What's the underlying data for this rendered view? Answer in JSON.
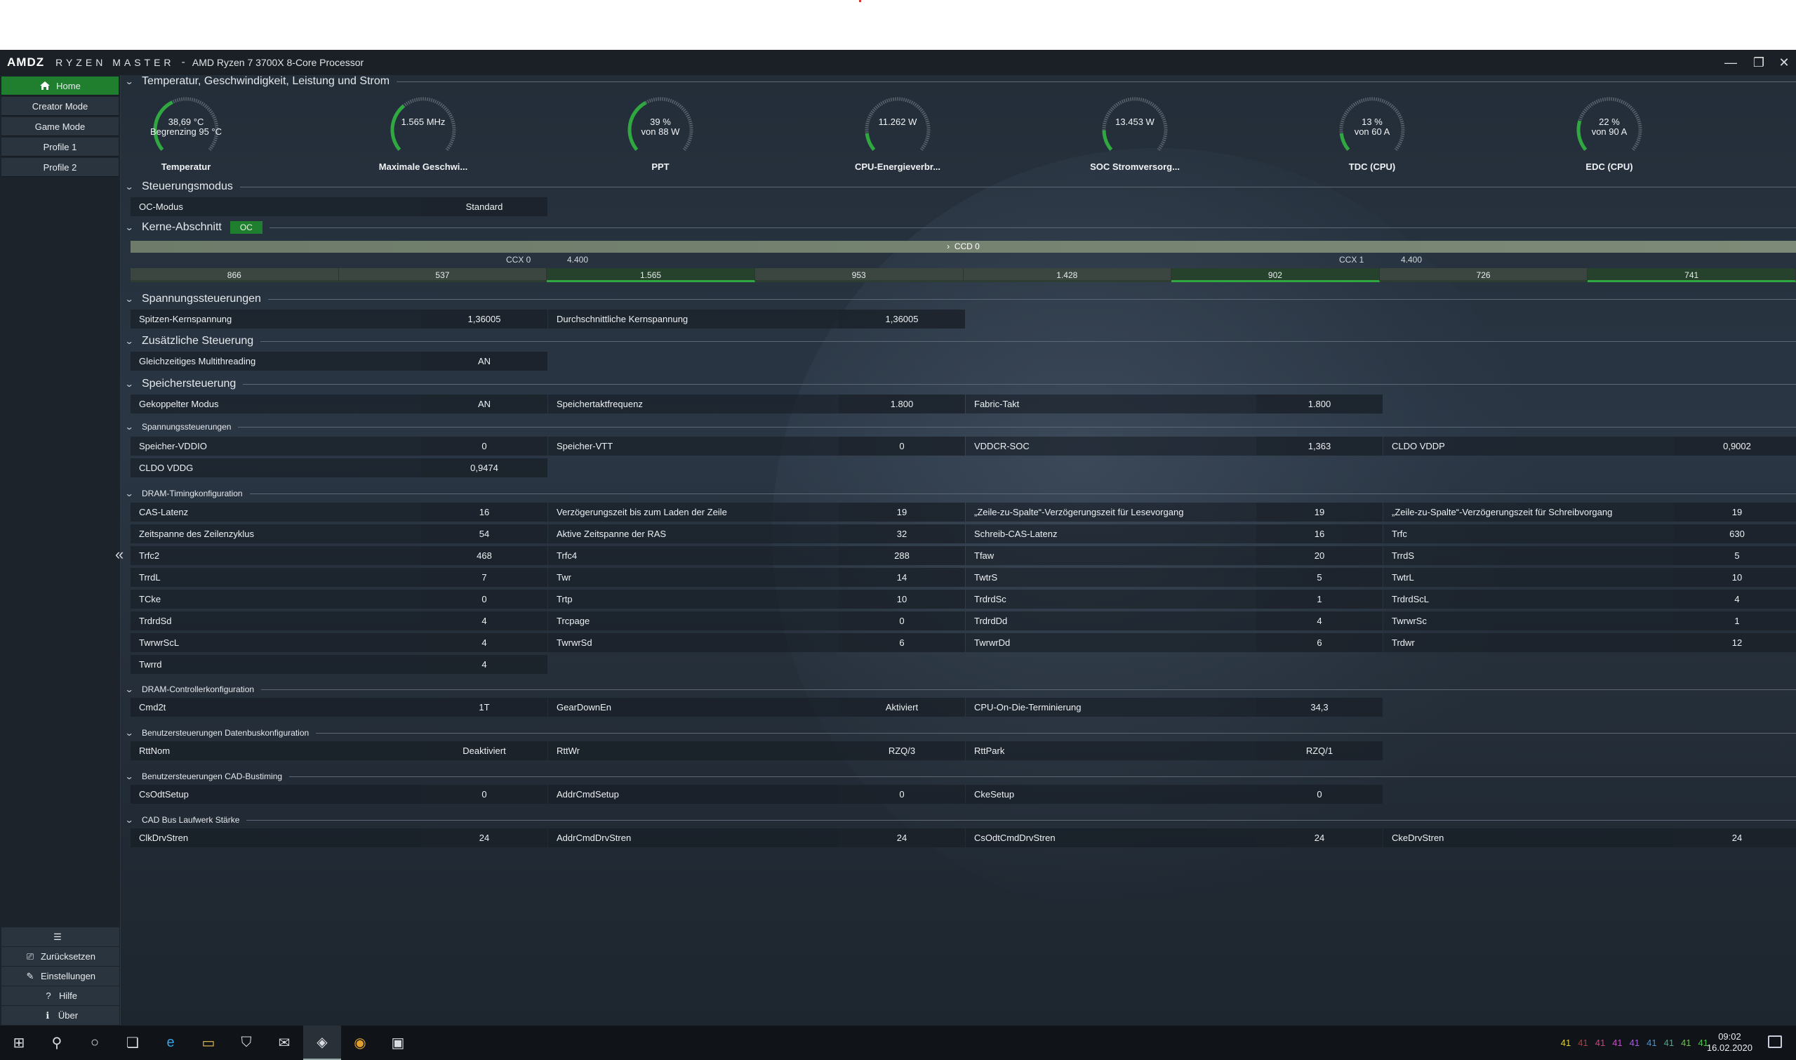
{
  "window": {
    "logo": "AMDΖ",
    "app_name": "RYZEN MASTER",
    "separator": "-",
    "cpu": "AMD Ryzen 7 3700X 8-Core Processor",
    "min": "—",
    "max": "❐",
    "close": "✕"
  },
  "sidebar": {
    "items": [
      {
        "label": "Home"
      },
      {
        "label": "Creator Mode"
      },
      {
        "label": "Game Mode"
      },
      {
        "label": "Profile 1"
      },
      {
        "label": "Profile 2"
      }
    ],
    "collapse": "«",
    "bottom": [
      {
        "label": "",
        "icon": "sliders-icon"
      },
      {
        "label": "Zurücksetzen",
        "icon": "reset-icon"
      },
      {
        "label": "Einstellungen",
        "icon": "settings-icon"
      },
      {
        "label": "Hilfe",
        "icon": "help-icon"
      },
      {
        "label": "Über",
        "icon": "info-icon"
      }
    ]
  },
  "sections": {
    "temp": "Temperatur, Geschwindigkeit, Leistung und Strom",
    "control_mode": "Steuerungsmodus",
    "cores": "Kerne-Abschnitt",
    "voltage": "Spannungssteuerungen",
    "additional": "Zusätzliche Steuerung",
    "memory": "Speichersteuerung",
    "mem_voltage": "Spannungssteuerungen",
    "dram_timing": "DRAM-Timingkonfiguration",
    "dram_ctrl": "DRAM-Controllerkonfiguration",
    "databus": "Benutzersteuerungen Datenbuskonfiguration",
    "cad": "Benutzersteuerungen CAD-Bustiming",
    "cad_drive": "CAD Bus Laufwerk Stärke"
  },
  "gauges": [
    {
      "line1": "38,69 °C",
      "line2": "Begrenzing 95 °C",
      "label": "Temperatur",
      "fraction": 0.4
    },
    {
      "line1": "1.565  MHz",
      "line2": "",
      "label": "Maximale Geschwi...",
      "fraction": 0.35
    },
    {
      "line1": "39 %",
      "line2": "von 88 W",
      "label": "PPT",
      "fraction": 0.39
    },
    {
      "line1": "11.262 W",
      "line2": "",
      "label": "CPU-Energieverbr...",
      "fraction": 0.13
    },
    {
      "line1": "13.453 W",
      "line2": "",
      "label": "SOC Stromversorg...",
      "fraction": 0.15
    },
    {
      "line1": "13 %",
      "line2": "von 60 A",
      "label": "TDC (CPU)",
      "fraction": 0.13
    },
    {
      "line1": "22 %",
      "line2": "von 90 A",
      "label": "EDC (CPU)",
      "fraction": 0.22
    }
  ],
  "control_mode": {
    "label": "OC-Modus",
    "value": "Standard"
  },
  "cores": {
    "badge": "OC",
    "ccd": "CCD 0",
    "ccd_chev": "›",
    "ccx0": "CCX 0",
    "ccx0_freq": "4.400",
    "ccx1": "CCX 1",
    "ccx1_freq": "4.400",
    "values": [
      "866",
      "537",
      "1.565",
      "953",
      "1.428",
      "902",
      "726",
      "741"
    ],
    "highlight": [
      false,
      false,
      true,
      false,
      false,
      true,
      false,
      true
    ]
  },
  "voltage": [
    {
      "label": "Spitzen-Kernspannung",
      "value": "1,36005"
    },
    {
      "label": "Durchschnittliche Kernspannung",
      "value": "1,36005"
    }
  ],
  "additional": [
    {
      "label": "Gleichzeitiges Multithreading",
      "value": "AN"
    }
  ],
  "memory": [
    {
      "label": "Gekoppelter Modus",
      "value": "AN"
    },
    {
      "label": "Speichertaktfrequenz",
      "value": "1.800"
    },
    {
      "label": "Fabric-Takt",
      "value": "1.800"
    }
  ],
  "mem_voltage": [
    [
      {
        "label": "Speicher-VDDIO",
        "value": "0"
      },
      {
        "label": "Speicher-VTT",
        "value": "0"
      },
      {
        "label": "VDDCR-SOC",
        "value": "1,363"
      },
      {
        "label": "CLDO VDDP",
        "value": "0,9002"
      }
    ],
    [
      {
        "label": "CLDO VDDG",
        "value": "0,9474"
      }
    ]
  ],
  "dram_timing": [
    [
      {
        "label": "CAS-Latenz",
        "value": "16"
      },
      {
        "label": "Verzögerungszeit bis zum Laden der Zeile",
        "value": "19"
      },
      {
        "label": "„Zeile-zu-Spalte“-Verzögerungszeit für Lesevorgang",
        "value": "19"
      },
      {
        "label": "„Zeile-zu-Spalte“-Verzögerungszeit für Schreibvorgang",
        "value": "19"
      }
    ],
    [
      {
        "label": "Zeitspanne des Zeilenzyklus",
        "value": "54"
      },
      {
        "label": "Aktive Zeitspanne der RAS",
        "value": "32"
      },
      {
        "label": "Schreib-CAS-Latenz",
        "value": "16"
      },
      {
        "label": "Trfc",
        "value": "630"
      }
    ],
    [
      {
        "label": "Trfc2",
        "value": "468"
      },
      {
        "label": "Trfc4",
        "value": "288"
      },
      {
        "label": "Tfaw",
        "value": "20"
      },
      {
        "label": "TrrdS",
        "value": "5"
      }
    ],
    [
      {
        "label": "TrrdL",
        "value": "7"
      },
      {
        "label": "Twr",
        "value": "14"
      },
      {
        "label": "TwtrS",
        "value": "5"
      },
      {
        "label": "TwtrL",
        "value": "10"
      }
    ],
    [
      {
        "label": "TCke",
        "value": "0"
      },
      {
        "label": "Trtp",
        "value": "10"
      },
      {
        "label": "TrdrdSc",
        "value": "1"
      },
      {
        "label": "TrdrdScL",
        "value": "4"
      }
    ],
    [
      {
        "label": "TrdrdSd",
        "value": "4"
      },
      {
        "label": "Trcpage",
        "value": "0"
      },
      {
        "label": "TrdrdDd",
        "value": "4"
      },
      {
        "label": "TwrwrSc",
        "value": "1"
      }
    ],
    [
      {
        "label": "TwrwrScL",
        "value": "4"
      },
      {
        "label": "TwrwrSd",
        "value": "6"
      },
      {
        "label": "TwrwrDd",
        "value": "6"
      },
      {
        "label": "Trdwr",
        "value": "12"
      }
    ],
    [
      {
        "label": "Twrrd",
        "value": "4"
      }
    ]
  ],
  "dram_ctrl": [
    {
      "label": "Cmd2t",
      "value": "1T"
    },
    {
      "label": "GearDownEn",
      "value": "Aktiviert"
    },
    {
      "label": "CPU-On-Die-Terminierung",
      "value": "34,3"
    }
  ],
  "databus": [
    {
      "label": "RttNom",
      "value": "Deaktiviert"
    },
    {
      "label": "RttWr",
      "value": "RZQ/3"
    },
    {
      "label": "RttPark",
      "value": "RZQ/1"
    }
  ],
  "cad": [
    {
      "label": "CsOdtSetup",
      "value": "0"
    },
    {
      "label": "AddrCmdSetup",
      "value": "0"
    },
    {
      "label": "CkeSetup",
      "value": "0"
    }
  ],
  "cad_drive": [
    {
      "label": "ClkDrvStren",
      "value": "24"
    },
    {
      "label": "AddrCmdDrvStren",
      "value": "24"
    },
    {
      "label": "CsOdtCmdDrvStren",
      "value": "24"
    },
    {
      "label": "CkeDrvStren",
      "value": "24"
    }
  ],
  "taskbar": {
    "icons": [
      "windows-start-icon",
      "search-icon",
      "cortana-icon",
      "task-view-icon",
      "edge-icon",
      "explorer-icon",
      "store-icon",
      "mail-icon",
      "ryzen-master-icon",
      "chrome-icon",
      "amd-app-icon"
    ],
    "tray_numbers": [
      "41",
      "41",
      "41",
      "41",
      "41",
      "41",
      "41",
      "41",
      "41"
    ],
    "tray_colors": [
      "#d8d040",
      "#b43a3a",
      "#d04080",
      "#c050c0",
      "#a060d0",
      "#4a90d0",
      "#40b080",
      "#70c050",
      "#50c050"
    ],
    "time": "09:02",
    "date": "16.02.2020"
  },
  "colors": {
    "accent": "#1f7f2f",
    "gauge_track": "#5a6570",
    "gauge_fill": "#2fa840"
  }
}
